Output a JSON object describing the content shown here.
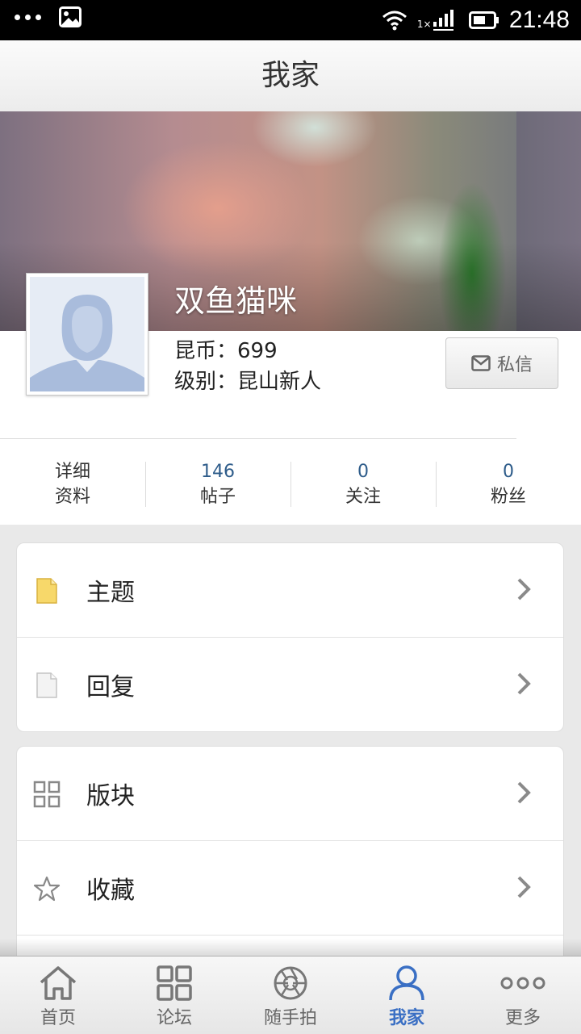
{
  "status_bar": {
    "time": "21:48",
    "signal_label": "1×"
  },
  "header": {
    "title": "我家"
  },
  "profile": {
    "username": "双鱼猫咪",
    "coins_label": "昆币：",
    "coins": "699",
    "level_label": "级别：",
    "level": "昆山新人",
    "message_button": "私信"
  },
  "stats": [
    {
      "line1": "详细",
      "line2": "资料"
    },
    {
      "line1": "146",
      "line2": "帖子"
    },
    {
      "line1": "0",
      "line2": "关注"
    },
    {
      "line1": "0",
      "line2": "粉丝"
    }
  ],
  "menu_groups": [
    [
      {
        "label": "主题",
        "icon": "topic-document-icon"
      },
      {
        "label": "回复",
        "icon": "reply-document-icon"
      }
    ],
    [
      {
        "label": "版块",
        "icon": "grid-icon"
      },
      {
        "label": "收藏",
        "icon": "star-icon"
      }
    ]
  ],
  "tabbar": [
    {
      "label": "首页",
      "icon": "home-icon"
    },
    {
      "label": "论坛",
      "icon": "grid-icon"
    },
    {
      "label": "随手拍",
      "icon": "camera-aperture-icon"
    },
    {
      "label": "我家",
      "icon": "person-icon",
      "active": true
    },
    {
      "label": "更多",
      "icon": "more-icon"
    }
  ],
  "colors": {
    "accent": "#3a6fc4",
    "stat_number": "#2e5c8a"
  }
}
